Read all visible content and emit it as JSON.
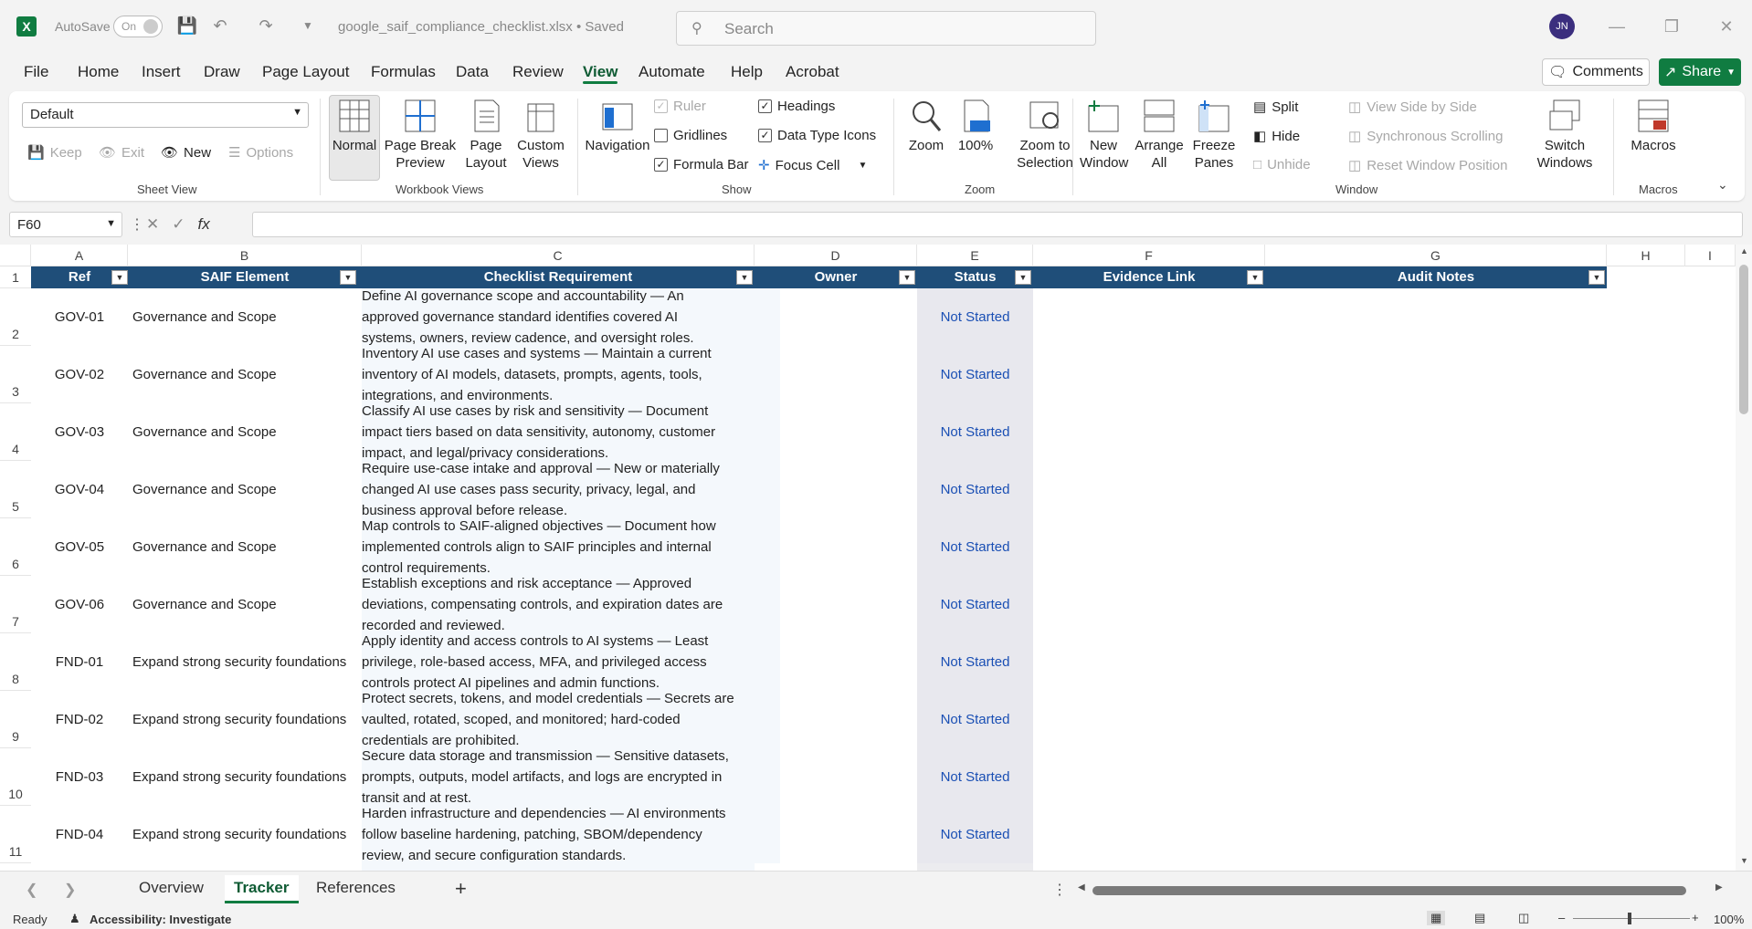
{
  "titlebar": {
    "autosave_label": "AutoSave",
    "autosave_state": "On",
    "filename": "google_saif_compliance_checklist.xlsx • Saved",
    "search_placeholder": "Search",
    "avatar_initials": "JN"
  },
  "menu": [
    "File",
    "Home",
    "Insert",
    "Draw",
    "Page Layout",
    "Formulas",
    "Data",
    "Review",
    "View",
    "Automate",
    "Help",
    "Acrobat"
  ],
  "comments_label": "Comments",
  "share_label": "Share",
  "ribbon": {
    "sheet_view": {
      "select_value": "Default",
      "keep": "Keep",
      "exit": "Exit",
      "new": "New",
      "options": "Options",
      "label": "Sheet View"
    },
    "workbook_views": {
      "normal": "Normal",
      "page_break": "Page Break Preview",
      "page_layout": "Page Layout",
      "custom_views": "Custom Views",
      "label": "Workbook Views"
    },
    "show": {
      "navigation": "Navigation",
      "ruler": "Ruler",
      "gridlines": "Gridlines",
      "formula_bar": "Formula Bar",
      "headings": "Headings",
      "data_type_icons": "Data Type Icons",
      "focus_cell": "Focus Cell",
      "label": "Show"
    },
    "zoom": {
      "zoom": "Zoom",
      "hundred": "100%",
      "zoom_to_selection": "Zoom to Selection",
      "label": "Zoom"
    },
    "window": {
      "new_window": "New Window",
      "arrange_all": "Arrange All",
      "freeze_panes": "Freeze Panes",
      "split": "Split",
      "hide": "Hide",
      "unhide": "Unhide",
      "view_side_by_side": "View Side by Side",
      "sync_scrolling": "Synchronous Scrolling",
      "reset_window": "Reset Window Position",
      "switch_windows": "Switch Windows",
      "label": "Window"
    },
    "macros": {
      "macros": "Macros",
      "label": "Macros"
    }
  },
  "namebox": "F60",
  "columns": [
    "A",
    "B",
    "C",
    "D",
    "E",
    "F",
    "G",
    "H",
    "I"
  ],
  "headers": {
    "ref": "Ref",
    "element": "SAIF Element",
    "requirement": "Checklist Requirement",
    "owner": "Owner",
    "status": "Status",
    "evidence": "Evidence Link",
    "notes": "Audit Notes"
  },
  "rows": [
    {
      "num": "2",
      "ref": "GOV-01",
      "element": "Governance and Scope",
      "req": [
        "Define AI governance scope and accountability — An",
        "approved governance standard identifies covered AI",
        "systems, owners, review cadence, and oversight roles."
      ],
      "status": "Not Started"
    },
    {
      "num": "3",
      "ref": "GOV-02",
      "element": "Governance and Scope",
      "req": [
        "Inventory AI use cases and systems — Maintain a current",
        "inventory of AI models, datasets, prompts, agents, tools,",
        "integrations, and environments."
      ],
      "status": "Not Started"
    },
    {
      "num": "4",
      "ref": "GOV-03",
      "element": "Governance and Scope",
      "req": [
        "Classify AI use cases by risk and sensitivity — Document",
        "impact tiers based on data sensitivity, autonomy, customer",
        "impact, and legal/privacy considerations."
      ],
      "status": "Not Started"
    },
    {
      "num": "5",
      "ref": "GOV-04",
      "element": "Governance and Scope",
      "req": [
        "Require use-case intake and approval — New or materially",
        "changed AI use cases pass security, privacy, legal, and",
        "business approval before release."
      ],
      "status": "Not Started"
    },
    {
      "num": "6",
      "ref": "GOV-05",
      "element": "Governance and Scope",
      "req": [
        "Map controls to SAIF-aligned objectives — Document how",
        "implemented controls align to SAIF principles and internal",
        "control requirements."
      ],
      "status": "Not Started"
    },
    {
      "num": "7",
      "ref": "GOV-06",
      "element": "Governance and Scope",
      "req": [
        "Establish exceptions and risk acceptance — Approved",
        "deviations, compensating controls, and expiration dates are",
        "recorded and reviewed."
      ],
      "status": "Not Started"
    },
    {
      "num": "8",
      "ref": "FND-01",
      "element": "Expand strong security foundations",
      "req": [
        "Apply identity and access controls to AI systems — Least",
        "privilege, role-based access, MFA, and privileged access",
        "controls protect AI pipelines and admin functions."
      ],
      "status": "Not Started"
    },
    {
      "num": "9",
      "ref": "FND-02",
      "element": "Expand strong security foundations",
      "req": [
        "Protect secrets, tokens, and model credentials — Secrets are",
        "vaulted, rotated, scoped, and monitored; hard-coded",
        "credentials are prohibited."
      ],
      "status": "Not Started"
    },
    {
      "num": "10",
      "ref": "FND-03",
      "element": "Expand strong security foundations",
      "req": [
        "Secure data storage and transmission — Sensitive datasets,",
        "prompts, outputs, model artifacts, and logs are encrypted in",
        "transit and at rest."
      ],
      "status": "Not Started"
    },
    {
      "num": "11",
      "ref": "FND-04",
      "element": "Expand strong security foundations",
      "req": [
        "Harden infrastructure and dependencies — AI environments",
        "follow baseline hardening, patching, SBOM/dependency",
        "review, and secure configuration standards."
      ],
      "status": "Not Started"
    }
  ],
  "sheets": [
    "Overview",
    "Tracker",
    "References"
  ],
  "status_bar": {
    "ready": "Ready",
    "accessibility": "Accessibility: Investigate",
    "zoom": "100%"
  },
  "colors": {
    "excel_green": "#107c41",
    "header_fill": "#1f4e79",
    "status_text": "#1a4fb4"
  }
}
